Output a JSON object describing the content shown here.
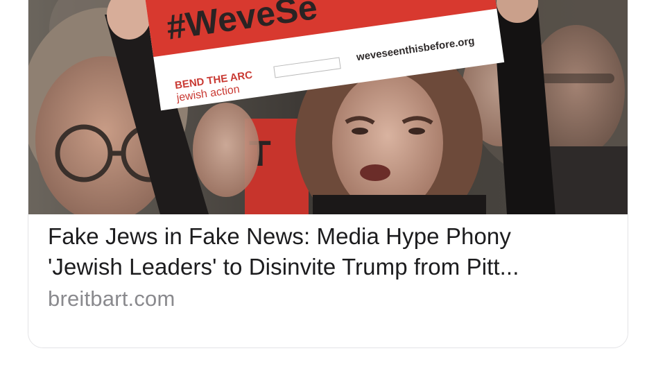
{
  "card": {
    "headline_line1": "Fake Jews in Fake News: Media Hype Phony",
    "headline_line2": "'Jewish Leaders' to Disinvite Trump from Pitt...",
    "domain": "breitbart.com"
  },
  "photo": {
    "sign_hashtag": "#WeveSe",
    "sign_url": "weveseenthisbefore.org",
    "sign_brand": "BEND THE ARC",
    "sign_brand_sub": "jewish action",
    "sign_partial": "T"
  },
  "colors": {
    "sign_red": "#d8392f",
    "headline_text": "#1c1c1e",
    "domain_text": "#8a8a8e"
  }
}
